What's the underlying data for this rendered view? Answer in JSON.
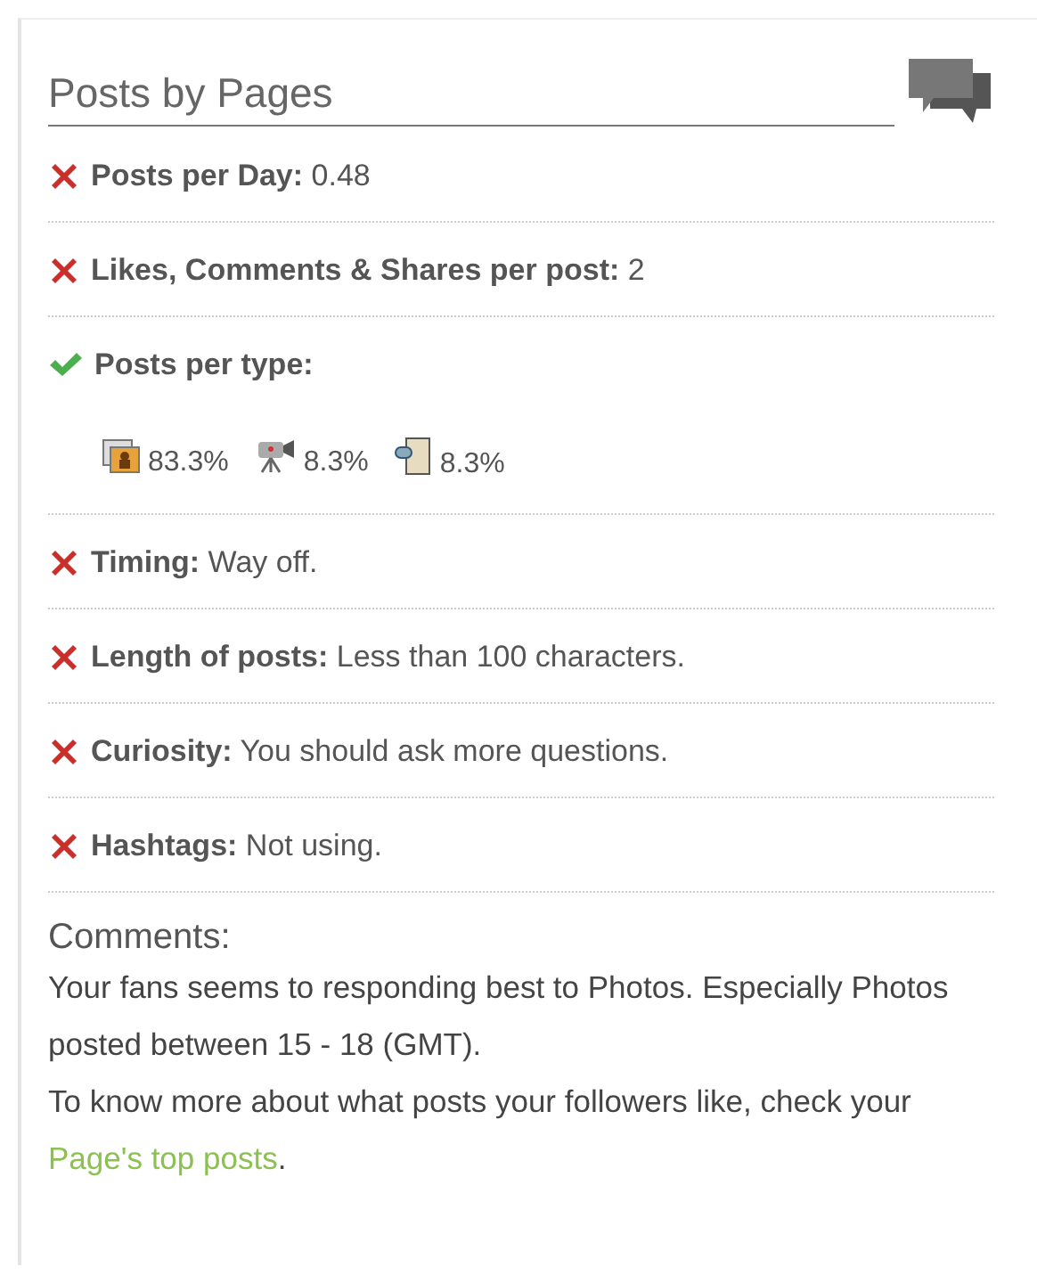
{
  "panel": {
    "title": "Posts by Pages"
  },
  "checks": [
    {
      "kind": "metric",
      "passed": false,
      "label": "Posts per Day:",
      "value": "0.48"
    },
    {
      "kind": "metric",
      "passed": false,
      "label": "Likes, Comments & Shares per post:",
      "value": "2"
    },
    {
      "kind": "types",
      "passed": true,
      "label": "Posts per type:",
      "types": [
        {
          "kind": "photo",
          "share": "83.3%"
        },
        {
          "kind": "video",
          "share": "8.3%"
        },
        {
          "kind": "link",
          "share": "8.3%"
        }
      ]
    },
    {
      "kind": "metric",
      "passed": false,
      "label": "Timing:",
      "value": "Way off."
    },
    {
      "kind": "metric",
      "passed": false,
      "label": "Length of posts:",
      "value": "Less than 100 characters."
    },
    {
      "kind": "metric",
      "passed": false,
      "label": "Curiosity:",
      "value": "You should ask more questions."
    },
    {
      "kind": "metric",
      "passed": false,
      "label": "Hashtags:",
      "value": "Not using."
    }
  ],
  "comments": {
    "heading": "Comments:",
    "paragraphs": [
      {
        "text": "Your fans seems to responding best to Photos. Especially Photos posted between 15 - 18 (GMT)."
      },
      {
        "text": "To know more about what posts your followers like, check your",
        "link": "Page's top posts",
        "after": "."
      }
    ]
  }
}
